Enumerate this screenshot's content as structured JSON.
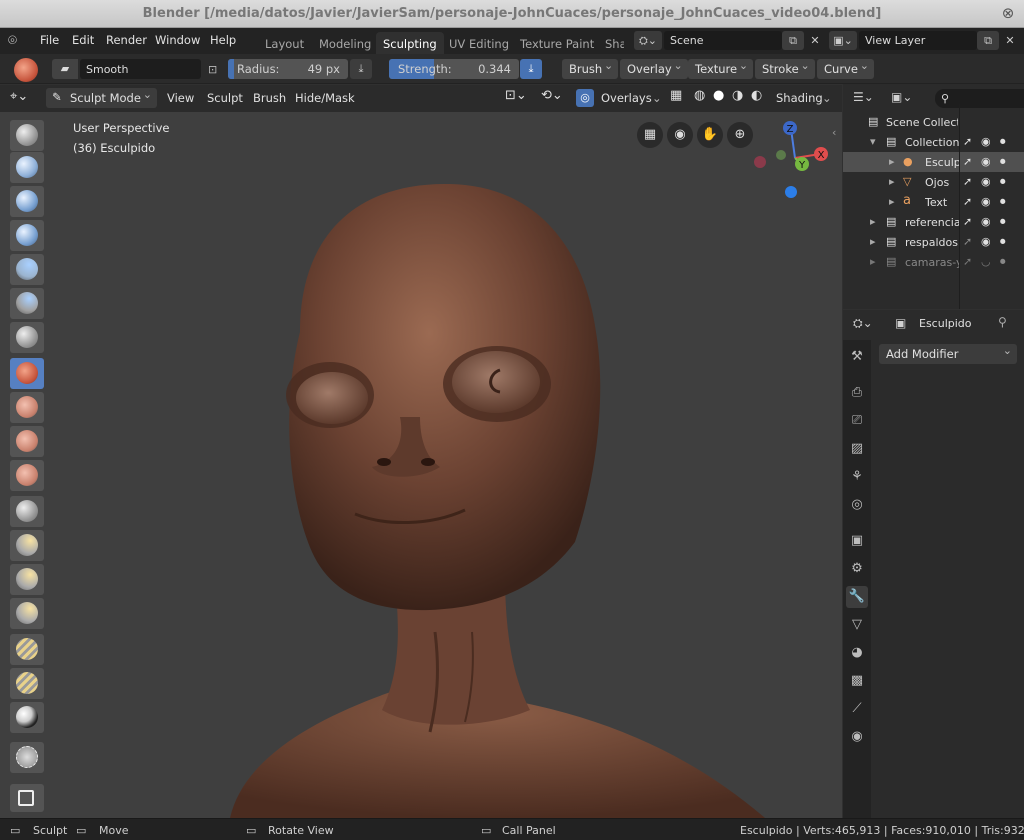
{
  "window": {
    "title": "Blender [/media/datos/Javier/JavierSam/personaje-JohnCuaces/personaje_JohnCuaces_video04.blend]"
  },
  "menu": [
    "File",
    "Edit",
    "Render",
    "Window",
    "Help"
  ],
  "workspaces": [
    "Layout",
    "Modeling",
    "Sculpting",
    "UV Editing",
    "Texture Paint",
    "Sha"
  ],
  "active_workspace": "Sculpting",
  "scene": {
    "name": "Scene",
    "view_layer": "View Layer"
  },
  "tool_settings": {
    "brush_name": "Smooth",
    "radius_label": "Radius:",
    "radius_value": "49 px",
    "strength_label": "Strength:",
    "strength_value": "0.344",
    "strength_fraction": 0.344,
    "menus": [
      "Brush",
      "Overlay",
      "Texture",
      "Stroke",
      "Curve"
    ]
  },
  "viewport_header": {
    "mode": "Sculpt Mode",
    "menus": [
      "View",
      "Sculpt",
      "Brush",
      "Hide/Mask"
    ],
    "overlays": "Overlays",
    "shading": "Shading"
  },
  "viewport": {
    "perspective": "User Perspective",
    "object_info": "(36) Esculpido",
    "gizmo": {
      "z": "Z",
      "y": "Y",
      "x": "X"
    }
  },
  "outliner": {
    "search_placeholder": "",
    "rows": [
      {
        "label": "Scene Collecti"
      },
      {
        "label": "Collection"
      },
      {
        "label": "Esculp"
      },
      {
        "label": "Ojos"
      },
      {
        "label": "Text"
      },
      {
        "label": "referencia"
      },
      {
        "label": "respaldos"
      },
      {
        "label": "camaras-y"
      }
    ]
  },
  "properties": {
    "object_name": "Esculpido",
    "add_modifier": "Add Modifier"
  },
  "status": {
    "sculpt": "Sculpt",
    "move": "Move",
    "rotate": "Rotate View",
    "call_panel": "Call Panel",
    "stats": "Esculpido | Verts:465,913 | Faces:910,010 | Tris:932,02("
  },
  "colors": {
    "accent": "#5680c2",
    "active_tool": "#5680c2",
    "slider_fill": "#4772b3"
  }
}
